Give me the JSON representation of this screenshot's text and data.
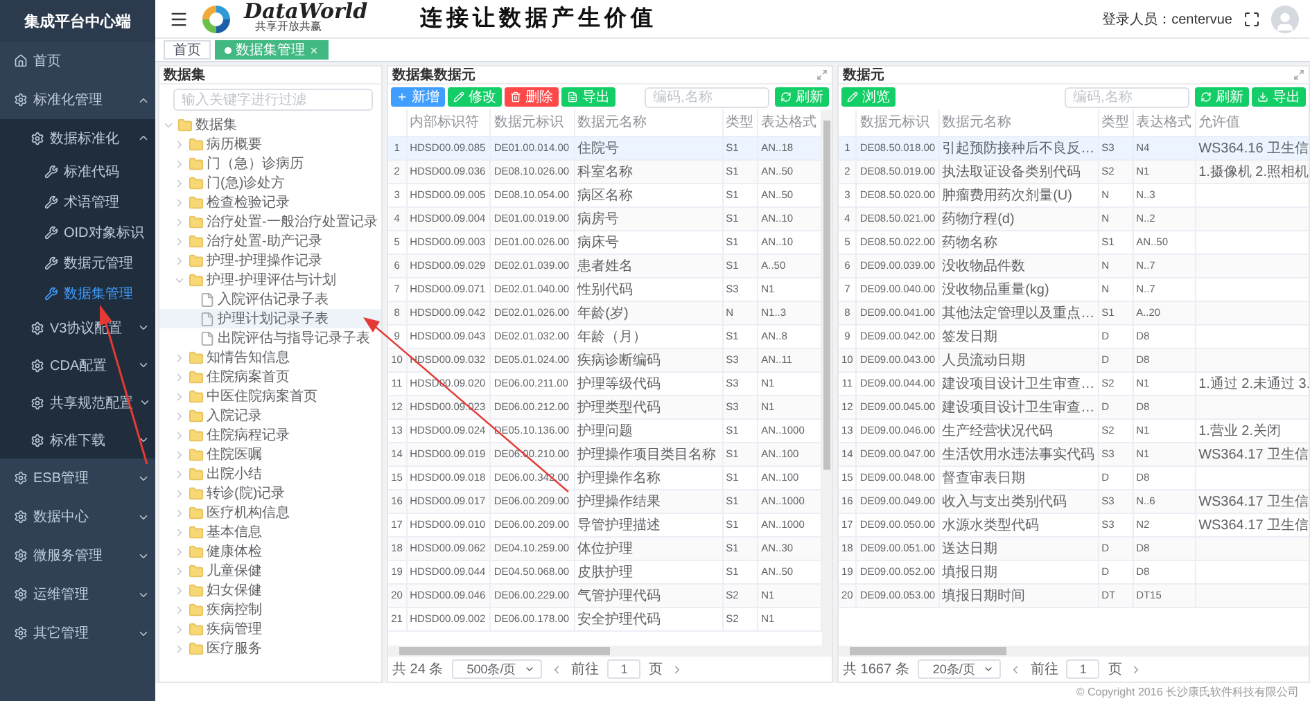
{
  "sidebar": {
    "title": "集成平台中心端",
    "items": [
      {
        "label": "首页",
        "kind": "page",
        "selected": false
      },
      {
        "label": "标准化管理",
        "kind": "group",
        "expanded": true,
        "children": [
          {
            "label": "数据标准化",
            "kind": "group",
            "expanded": true,
            "children": [
              {
                "label": "标准代码",
                "kind": "leaf",
                "selected": false
              },
              {
                "label": "术语管理",
                "kind": "leaf",
                "selected": false
              },
              {
                "label": "OID对象标识",
                "kind": "leaf",
                "selected": false
              },
              {
                "label": "数据元管理",
                "kind": "leaf",
                "selected": false
              },
              {
                "label": "数据集管理",
                "kind": "leaf",
                "selected": true
              }
            ]
          },
          {
            "label": "V3协议配置",
            "kind": "group",
            "expanded": false
          },
          {
            "label": "CDA配置",
            "kind": "group",
            "expanded": false
          },
          {
            "label": "共享规范配置",
            "kind": "group",
            "expanded": false
          },
          {
            "label": "标准下载",
            "kind": "group",
            "expanded": false
          }
        ]
      },
      {
        "label": "ESB管理",
        "kind": "group",
        "expanded": false
      },
      {
        "label": "数据中心",
        "kind": "group",
        "expanded": false
      },
      {
        "label": "微服务管理",
        "kind": "group",
        "expanded": false
      },
      {
        "label": "运维管理",
        "kind": "group",
        "expanded": false
      },
      {
        "label": "其它管理",
        "kind": "group",
        "expanded": false
      }
    ]
  },
  "header": {
    "brand": "DataWorld",
    "tagline": "共享开放共赢",
    "slogan": "连接让数据产生价值",
    "user": "登录人员：centervue"
  },
  "tabs": [
    {
      "label": "首页",
      "selected": false,
      "closable": false
    },
    {
      "label": "数据集管理",
      "selected": true,
      "closable": true
    }
  ],
  "dataset_tree": {
    "title": "数据集",
    "placeholder": "输入关键字进行过滤",
    "nodes": [
      {
        "label": "数据集",
        "kind": "folder",
        "expanded": true,
        "selected": false,
        "children": [
          {
            "label": "病历概要",
            "kind": "folder",
            "expanded": false,
            "selected": false
          },
          {
            "label": "门（急）诊病历",
            "kind": "folder",
            "expanded": false,
            "selected": false
          },
          {
            "label": "门(急)诊处方",
            "kind": "folder",
            "expanded": false,
            "selected": false
          },
          {
            "label": "检查检验记录",
            "kind": "folder",
            "expanded": false,
            "selected": false
          },
          {
            "label": "治疗处置-一般治疗处置记录",
            "kind": "folder",
            "expanded": false,
            "selected": false
          },
          {
            "label": "治疗处置-助产记录",
            "kind": "folder",
            "expanded": false,
            "selected": false
          },
          {
            "label": "护理-护理操作记录",
            "kind": "folder",
            "expanded": false,
            "selected": false
          },
          {
            "label": "护理-护理评估与计划",
            "kind": "folder",
            "expanded": true,
            "selected": false,
            "children": [
              {
                "label": "入院评估记录子表",
                "kind": "file",
                "selected": false
              },
              {
                "label": "护理计划记录子表",
                "kind": "file",
                "selected": true
              },
              {
                "label": "出院评估与指导记录子表",
                "kind": "file",
                "selected": false
              }
            ]
          },
          {
            "label": "知情告知信息",
            "kind": "folder",
            "expanded": false,
            "selected": false
          },
          {
            "label": "住院病案首页",
            "kind": "folder",
            "expanded": false,
            "selected": false
          },
          {
            "label": "中医住院病案首页",
            "kind": "folder",
            "expanded": false,
            "selected": false
          },
          {
            "label": "入院记录",
            "kind": "folder",
            "expanded": false,
            "selected": false
          },
          {
            "label": "住院病程记录",
            "kind": "folder",
            "expanded": false,
            "selected": false
          },
          {
            "label": "住院医嘱",
            "kind": "folder",
            "expanded": false,
            "selected": false
          },
          {
            "label": "出院小结",
            "kind": "folder",
            "expanded": false,
            "selected": false
          },
          {
            "label": "转诊(院)记录",
            "kind": "folder",
            "expanded": false,
            "selected": false
          },
          {
            "label": "医疗机构信息",
            "kind": "folder",
            "expanded": false,
            "selected": false
          },
          {
            "label": "基本信息",
            "kind": "folder",
            "expanded": false,
            "selected": false
          },
          {
            "label": "健康体检",
            "kind": "folder",
            "expanded": false,
            "selected": false
          },
          {
            "label": "儿童保健",
            "kind": "folder",
            "expanded": false,
            "selected": false
          },
          {
            "label": "妇女保健",
            "kind": "folder",
            "expanded": false,
            "selected": false
          },
          {
            "label": "疾病控制",
            "kind": "folder",
            "expanded": false,
            "selected": false
          },
          {
            "label": "疾病管理",
            "kind": "folder",
            "expanded": false,
            "selected": false
          },
          {
            "label": "医疗服务",
            "kind": "folder",
            "expanded": false,
            "selected": false
          }
        ]
      }
    ]
  },
  "dataset_elements": {
    "title": "数据集数据元",
    "toolbar": {
      "left": [
        {
          "label": "新增",
          "kind": "add"
        },
        {
          "label": "修改",
          "kind": "edit"
        },
        {
          "label": "删除",
          "kind": "delete"
        },
        {
          "label": "导出",
          "kind": "export"
        }
      ],
      "right": [
        {
          "label": "刷新",
          "kind": "refresh"
        }
      ]
    },
    "search": {
      "placeholder": "编码,名称"
    },
    "columns": [
      "",
      "内部标识符",
      "数据元标识",
      "数据元名称",
      "类型",
      "表达格式"
    ],
    "rows": [
      {
        "selected": true,
        "cells": [
          "1",
          "HDSD00.09.085",
          "DE01.00.014.00",
          "住院号",
          "S1",
          "AN..18"
        ]
      },
      {
        "selected": false,
        "cells": [
          "2",
          "HDSD00.09.036",
          "DE08.10.026.00",
          "科室名称",
          "S1",
          "AN..50"
        ]
      },
      {
        "selected": false,
        "cells": [
          "3",
          "HDSD00.09.005",
          "DE08.10.054.00",
          "病区名称",
          "S1",
          "AN..50"
        ]
      },
      {
        "selected": false,
        "cells": [
          "4",
          "HDSD00.09.004",
          "DE01.00.019.00",
          "病房号",
          "S1",
          "AN..10"
        ]
      },
      {
        "selected": false,
        "cells": [
          "5",
          "HDSD00.09.003",
          "DE01.00.026.00",
          "病床号",
          "S1",
          "AN..10"
        ]
      },
      {
        "selected": false,
        "cells": [
          "6",
          "HDSD00.09.029",
          "DE02.01.039.00",
          "患者姓名",
          "S1",
          "A..50"
        ]
      },
      {
        "selected": false,
        "cells": [
          "7",
          "HDSD00.09.071",
          "DE02.01.040.00",
          "性别代码",
          "S3",
          "N1"
        ]
      },
      {
        "selected": false,
        "cells": [
          "8",
          "HDSD00.09.042",
          "DE02.01.026.00",
          "年龄(岁)",
          "N",
          "N1..3"
        ]
      },
      {
        "selected": false,
        "cells": [
          "9",
          "HDSD00.09.043",
          "DE02.01.032.00",
          "年龄（月）",
          "S1",
          "AN..8"
        ]
      },
      {
        "selected": false,
        "cells": [
          "10",
          "HDSD00.09.032",
          "DE05.01.024.00",
          "疾病诊断编码",
          "S3",
          "AN..11"
        ]
      },
      {
        "selected": false,
        "cells": [
          "11",
          "HDSD00.09.020",
          "DE06.00.211.00",
          "护理等级代码",
          "S3",
          "N1"
        ]
      },
      {
        "selected": false,
        "cells": [
          "12",
          "HDSD00.09.023",
          "DE06.00.212.00",
          "护理类型代码",
          "S3",
          "N1"
        ]
      },
      {
        "selected": false,
        "cells": [
          "13",
          "HDSD00.09.024",
          "DE05.10.136.00",
          "护理问题",
          "S1",
          "AN..1000"
        ]
      },
      {
        "selected": false,
        "cells": [
          "14",
          "HDSD00.09.019",
          "DE06.00.210.00",
          "护理操作项目类目名称",
          "S1",
          "AN..100"
        ]
      },
      {
        "selected": false,
        "cells": [
          "15",
          "HDSD00.09.018",
          "DE06.00.342.00",
          "护理操作名称",
          "S1",
          "AN..100"
        ]
      },
      {
        "selected": false,
        "cells": [
          "16",
          "HDSD00.09.017",
          "DE06.00.209.00",
          "护理操作结果",
          "S1",
          "AN..1000"
        ]
      },
      {
        "selected": false,
        "cells": [
          "17",
          "HDSD00.09.010",
          "DE06.00.209.00",
          "导管护理描述",
          "S1",
          "AN..1000"
        ]
      },
      {
        "selected": false,
        "cells": [
          "18",
          "HDSD00.09.062",
          "DE04.10.259.00",
          "体位护理",
          "S1",
          "AN..30"
        ]
      },
      {
        "selected": false,
        "cells": [
          "19",
          "HDSD00.09.044",
          "DE04.50.068.00",
          "皮肤护理",
          "S1",
          "AN..50"
        ]
      },
      {
        "selected": false,
        "cells": [
          "20",
          "HDSD00.09.046",
          "DE06.00.229.00",
          "气管护理代码",
          "S2",
          "N1"
        ]
      },
      {
        "selected": false,
        "cells": [
          "21",
          "HDSD00.09.002",
          "DE06.00.178.00",
          "安全护理代码",
          "S2",
          "N1"
        ]
      }
    ],
    "pagination": {
      "total": "共 24 条",
      "page_size": "500条/页",
      "goto": "前往",
      "page": "1",
      "unit": "页"
    }
  },
  "data_elements": {
    "title": "数据元",
    "toolbar": {
      "left": [
        {
          "label": "浏览",
          "kind": "browse"
        }
      ],
      "right": [
        {
          "label": "刷新",
          "kind": "refresh"
        },
        {
          "label": "导出",
          "kind": "download"
        }
      ]
    },
    "search": {
      "placeholder": "编码,名称"
    },
    "columns": [
      "",
      "数据元标识",
      "数据元名称",
      "类型",
      "表达格式",
      "允许值"
    ],
    "rows": [
      {
        "selected": true,
        "cells": [
          "1",
          "DE08.50.018.00",
          "引起预防接种后不良反…",
          "S3",
          "N4",
          "WS364.16 卫生信"
        ]
      },
      {
        "selected": false,
        "cells": [
          "2",
          "DE08.50.019.00",
          "执法取证设备类别代码",
          "S2",
          "N1",
          "1.摄像机 2.照相机"
        ]
      },
      {
        "selected": false,
        "cells": [
          "3",
          "DE08.50.020.00",
          "肿瘤费用药次剂量(U)",
          "N",
          "N..3",
          ""
        ]
      },
      {
        "selected": false,
        "cells": [
          "4",
          "DE08.50.021.00",
          "药物疗程(d)",
          "N",
          "N..2",
          ""
        ]
      },
      {
        "selected": false,
        "cells": [
          "5",
          "DE08.50.022.00",
          "药物名称",
          "S1",
          "AN..50",
          ""
        ]
      },
      {
        "selected": false,
        "cells": [
          "6",
          "DE09.00.039.00",
          "没收物品件数",
          "N",
          "N..7",
          ""
        ]
      },
      {
        "selected": false,
        "cells": [
          "7",
          "DE09.00.040.00",
          "没收物品重量(kg)",
          "N",
          "N..7",
          ""
        ]
      },
      {
        "selected": false,
        "cells": [
          "8",
          "DE09.00.041.00",
          "其他法定管理以及重点…",
          "S1",
          "A..20",
          ""
        ]
      },
      {
        "selected": false,
        "cells": [
          "9",
          "DE09.00.042.00",
          "签发日期",
          "D",
          "D8",
          ""
        ]
      },
      {
        "selected": false,
        "cells": [
          "10",
          "DE09.00.043.00",
          "人员流动日期",
          "D",
          "D8",
          ""
        ]
      },
      {
        "selected": false,
        "cells": [
          "11",
          "DE09.00.044.00",
          "建设项目设计卫生审查…",
          "S2",
          "N1",
          "1.通过 2.未通过 3."
        ]
      },
      {
        "selected": false,
        "cells": [
          "12",
          "DE09.00.045.00",
          "建设项目设计卫生审查…",
          "D",
          "D8",
          ""
        ]
      },
      {
        "selected": false,
        "cells": [
          "13",
          "DE09.00.046.00",
          "生产经营状况代码",
          "S2",
          "N1",
          "1.营业 2.关闭"
        ]
      },
      {
        "selected": false,
        "cells": [
          "14",
          "DE09.00.047.00",
          "生活饮用水违法事实代码",
          "S3",
          "N1",
          "WS364.17 卫生信"
        ]
      },
      {
        "selected": false,
        "cells": [
          "15",
          "DE09.00.048.00",
          "督查审表日期",
          "D",
          "D8",
          ""
        ]
      },
      {
        "selected": false,
        "cells": [
          "16",
          "DE09.00.049.00",
          "收入与支出类别代码",
          "S3",
          "N..6",
          "WS364.17 卫生信"
        ]
      },
      {
        "selected": false,
        "cells": [
          "17",
          "DE09.00.050.00",
          "水源水类型代码",
          "S3",
          "N2",
          "WS364.17 卫生信"
        ]
      },
      {
        "selected": false,
        "cells": [
          "18",
          "DE09.00.051.00",
          "送达日期",
          "D",
          "D8",
          ""
        ]
      },
      {
        "selected": false,
        "cells": [
          "19",
          "DE09.00.052.00",
          "填报日期",
          "D",
          "D8",
          ""
        ]
      },
      {
        "selected": false,
        "cells": [
          "20",
          "DE09.00.053.00",
          "填报日期时间",
          "DT",
          "DT15",
          ""
        ]
      }
    ],
    "pagination": {
      "total": "共 1667 条",
      "page_size": "20条/页",
      "goto": "前往",
      "page": "1",
      "unit": "页"
    }
  },
  "footer": "© Copyright 2016 长沙康氏软件科技有限公司"
}
